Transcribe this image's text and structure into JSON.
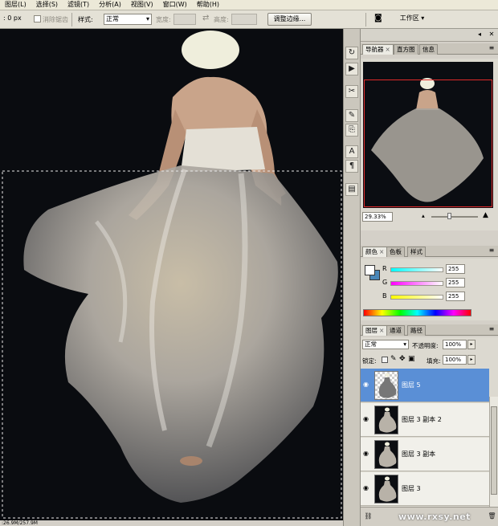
{
  "menu": [
    "图层(L)",
    "选择(S)",
    "滤镜(T)",
    "分析(A)",
    "视图(V)",
    "窗口(W)",
    "帮助(H)"
  ],
  "options": {
    "feather_value": ": 0 px",
    "antialias_label": "消除锯齿",
    "style_label": "样式:",
    "style_value": "正常",
    "width_label": "宽度:",
    "height_label": "高度:",
    "refine_edge_button": "调整边缘...",
    "workspace_button": "工作区 ▾"
  },
  "status_text": ":26.9M/257.9M",
  "panels": {
    "navigator_tabs": [
      "导航器",
      "直方图",
      "信息"
    ],
    "zoom_value": "29.33%",
    "color_tabs": [
      "颜色",
      "色板",
      "样式"
    ],
    "channels": [
      {
        "label": "R",
        "value": "255"
      },
      {
        "label": "G",
        "value": "255"
      },
      {
        "label": "B",
        "value": "255"
      }
    ],
    "layers_tabs": [
      "图层",
      "通道",
      "路径"
    ],
    "blend_mode": "正常",
    "opacity_label": "不透明度:",
    "opacity_value": "100%",
    "lock_label": "锁定:",
    "fill_label": "填充:",
    "fill_value": "100%",
    "layers": [
      {
        "name": "图层 5",
        "selected": true
      },
      {
        "name": "图层 3 副本 2",
        "selected": false
      },
      {
        "name": "图层 3 副本",
        "selected": false
      },
      {
        "name": "图层 3",
        "selected": false
      }
    ],
    "watermark": "www.rxsy.net"
  },
  "colors": {
    "selected_layer": "#5a8fd6",
    "navigator_frame": "#e02a2a",
    "background_swatch": "#4a87b8"
  }
}
